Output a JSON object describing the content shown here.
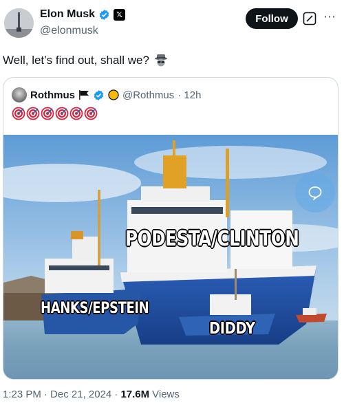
{
  "author": {
    "name": "Elon Musk",
    "handle": "@elonmusk",
    "verified_icon": "verified-badge-icon",
    "affiliation_icon": "x-logo-icon"
  },
  "actions": {
    "follow_label": "Follow",
    "grok_icon": "grok-icon",
    "more_icon": "more-icon"
  },
  "tweet": {
    "text": "Well, let’s find out, shall we?",
    "emoji": "detective-icon"
  },
  "quote": {
    "name": "Rothmus",
    "handle": "@Rothmus",
    "time": "· 12h",
    "icons": [
      "black-flag-icon",
      "verified-badge-icon",
      "gold-circle-icon"
    ],
    "target_emoji_count": "6",
    "image_labels": {
      "big_ship": "PODESTA/CLINTON",
      "medium_ship": "HANKS/EPSTEIN",
      "small_boat": "DIDDY"
    }
  },
  "footer": {
    "time": "1:23 PM",
    "date": "· Dec 21, 2024 ·",
    "views_count": "17.6M",
    "views_label": "Views"
  },
  "colors": {
    "text": "#0f1419",
    "muted": "#536471",
    "border": "#cfd9de",
    "verified": "#1d9bf0",
    "follow_bg": "#0f1419"
  }
}
